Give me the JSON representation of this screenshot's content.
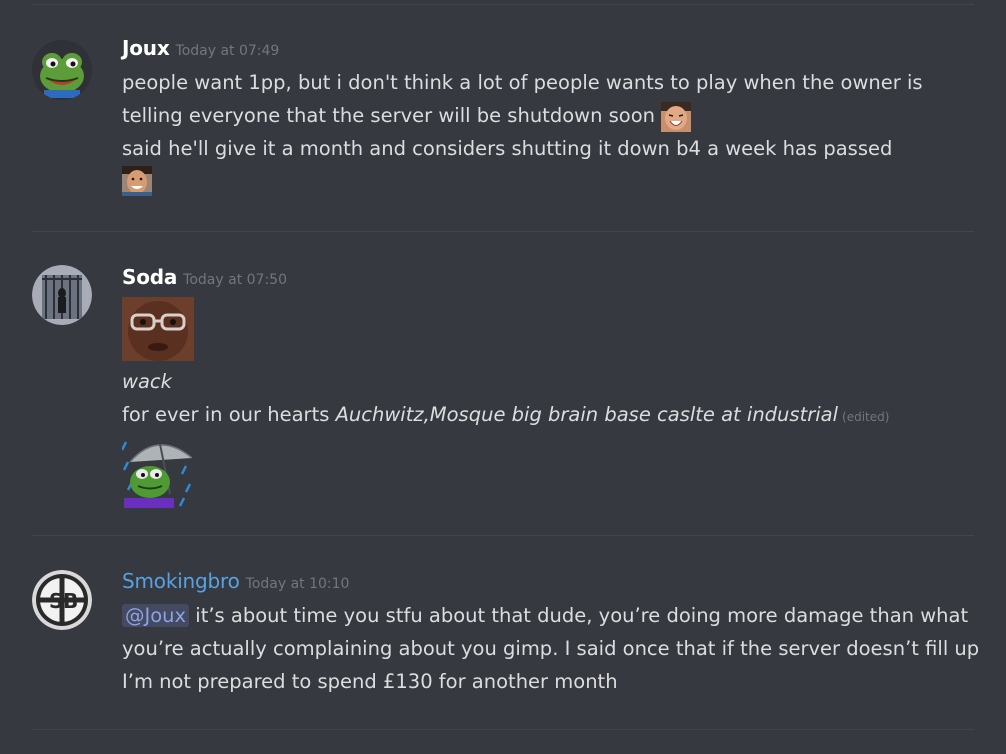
{
  "messages": [
    {
      "author": "Joux",
      "time": "Today at 07:49",
      "avatar_icon": "pepe-frog-avatar",
      "lines": [
        "people want 1pp, but i don't think a lot of people wants to play when the owner is",
        "telling everyone that the server will be shutdown soon",
        "said he'll give it a month and considers shutting it down b4 a week has passed"
      ],
      "emojis": [
        "laughing-face-emoji",
        "smiling-man-emoji"
      ]
    },
    {
      "author": "Soda",
      "time": "Today at 07:50",
      "avatar_icon": "caged-person-avatar",
      "image_emoji": "man-with-glasses-emoji",
      "line_wack": "wack",
      "line_hearts_prefix": "for ever in our hearts",
      "line_hearts_italic": "Auchwitz,Mosque big brain base caslte at industrial",
      "edited": "(edited)",
      "end_emoji": "pepe-umbrella-rain-emoji"
    },
    {
      "author": "Smokingbro",
      "time": "Today at 10:10",
      "avatar_icon": "sb-logo-avatar",
      "mention": "@Joux",
      "text": "it’s about time you stfu about that dude, you’re doing more damage than what you’re actually complaining about you gimp. I said once that if the server doesn’t fill up I’m not prepared to spend £130 for another month"
    }
  ],
  "colors": {
    "background": "#36393f",
    "divider": "#42454a",
    "username": "#ffffff",
    "username_role": "#57a2e3",
    "timestamp": "#72767d",
    "mention": "#8ea1e1"
  }
}
